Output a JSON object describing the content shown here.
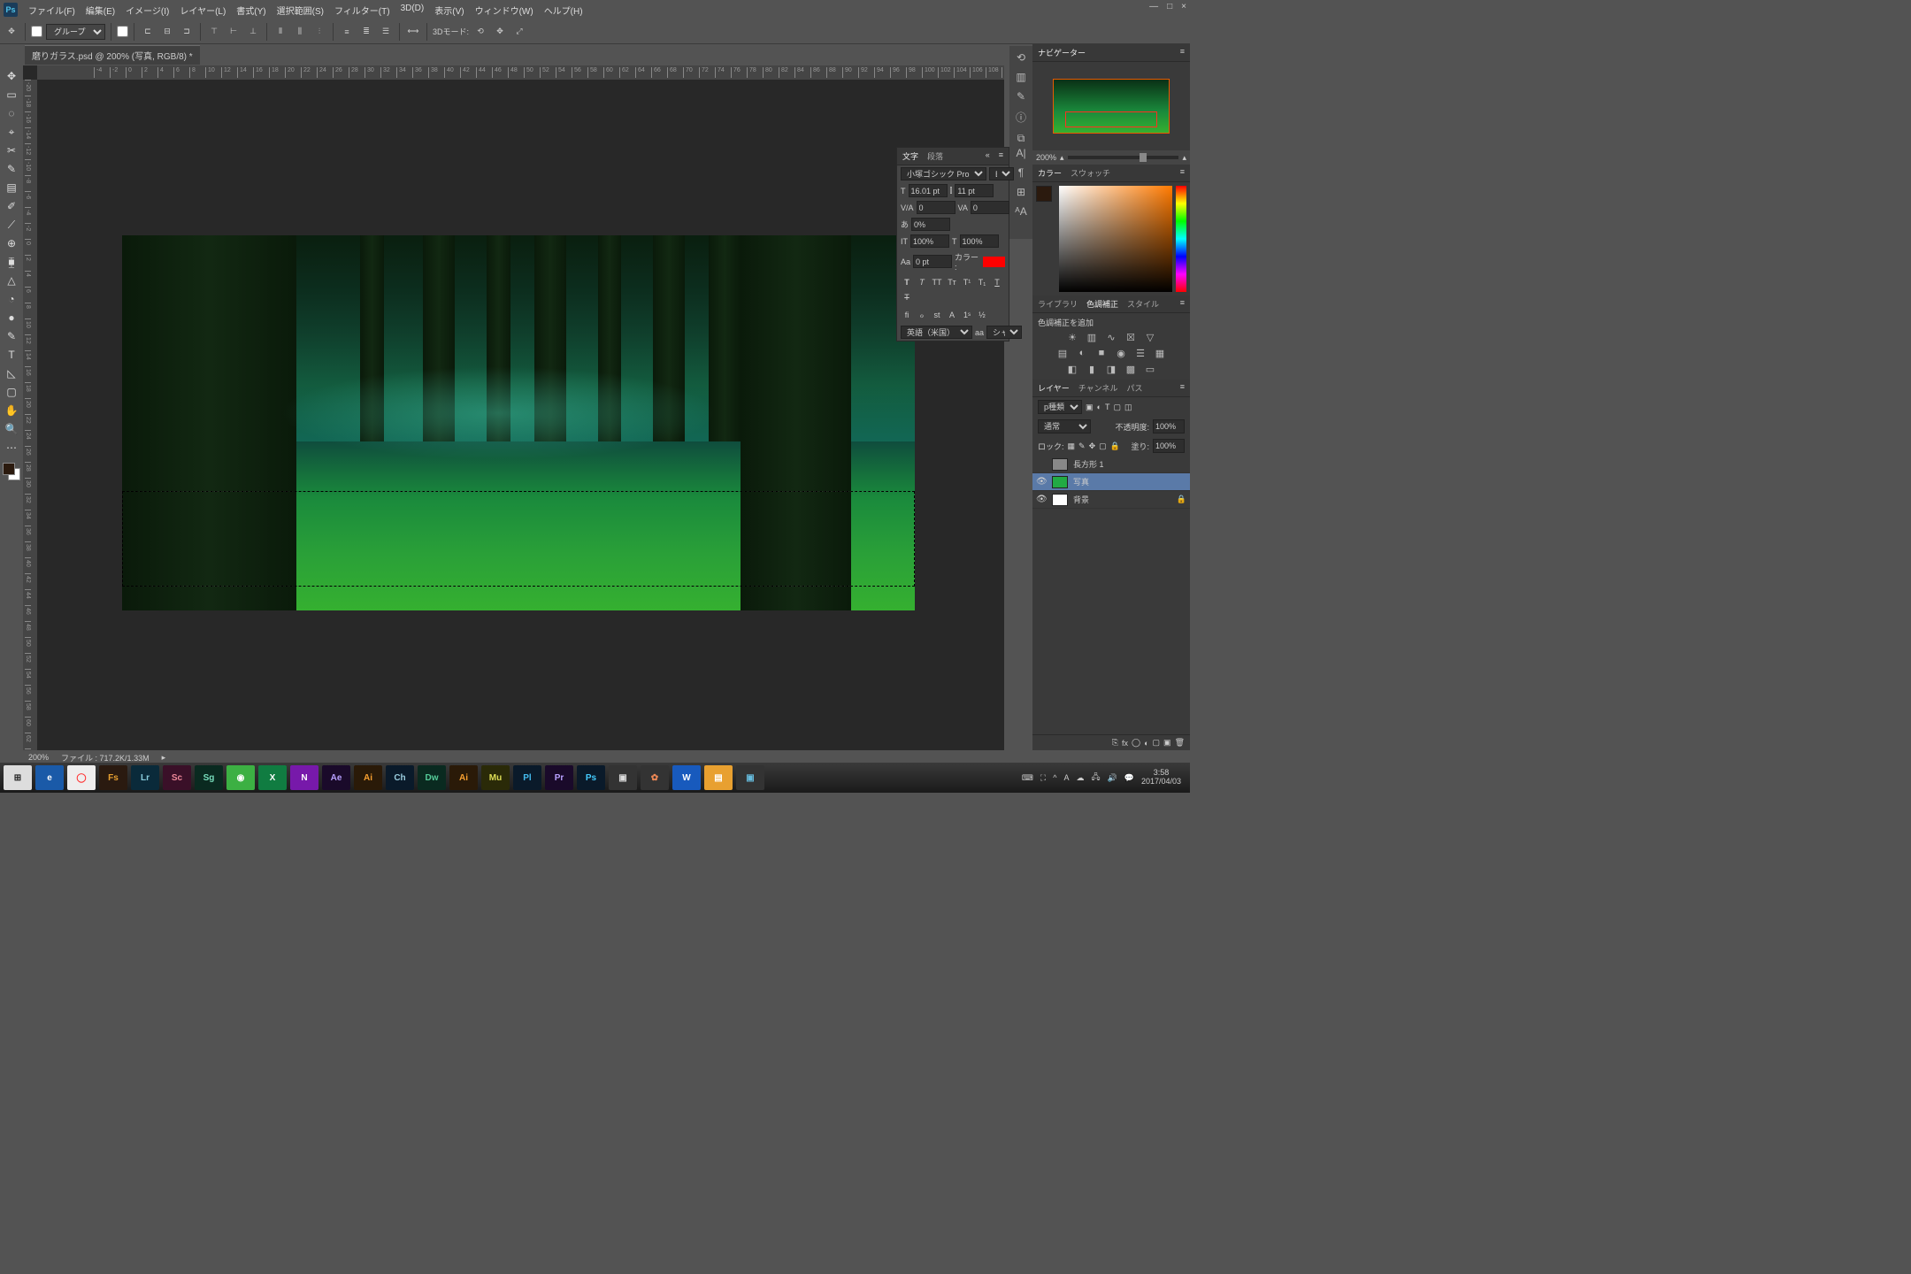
{
  "app": {
    "logo": "Ps"
  },
  "menu": [
    "ファイル(F)",
    "編集(E)",
    "イメージ(I)",
    "レイヤー(L)",
    "書式(Y)",
    "選択範囲(S)",
    "フィルター(T)",
    "3D(D)",
    "表示(V)",
    "ウィンドウ(W)",
    "ヘルプ(H)"
  ],
  "opt": {
    "group": "グループ",
    "mode3d": "3Dモード:"
  },
  "doc": {
    "tab": "磨りガラス.psd @ 200% (写真, RGB/8) *"
  },
  "status": {
    "zoom": "200%",
    "info": "ファイル : 717.2K/1.33M"
  },
  "navigator": {
    "title": "ナビゲーター",
    "zoom": "200%"
  },
  "color": {
    "tab1": "カラー",
    "tab2": "スウォッチ"
  },
  "lib": {
    "tab1": "ライブラリ",
    "tab2": "色調補正",
    "tab3": "スタイル",
    "add": "色調補正を追加"
  },
  "layers": {
    "tab1": "レイヤー",
    "tab2": "チャンネル",
    "tab3": "パス",
    "kind": "p種類",
    "blend": "通常",
    "opacityLabel": "不透明度:",
    "opacity": "100%",
    "lock": "ロック:",
    "fillLabel": "塗り:",
    "fill": "100%",
    "l1": "長方形 1",
    "l2": "写真",
    "l3": "背景"
  },
  "char": {
    "tab1": "文字",
    "tab2": "段落",
    "font": "小塚ゴシック Pro",
    "style": "B",
    "size": "16.01 pt",
    "leading": "11 pt",
    "va": "0",
    "vb": "0",
    "tsume": "0%",
    "pt0": "0 pt",
    "scaleH": "100%",
    "scaleV": "100%",
    "colorLabel": "カラー :",
    "lang": "英語（米国）",
    "aa": "シャープ"
  },
  "clock": {
    "time": "3:58",
    "date": "2017/04/03"
  },
  "taskbarApps": [
    {
      "t": "⊞",
      "bg": "#ddd",
      "c": "#222"
    },
    {
      "t": "e",
      "bg": "#1a5aa8",
      "c": "#fff"
    },
    {
      "t": "◯",
      "bg": "#eee",
      "c": "#f33"
    },
    {
      "t": "Fs",
      "bg": "#2a1a10",
      "c": "#e8a030"
    },
    {
      "t": "Lr",
      "bg": "#0a2a3a",
      "c": "#8cd"
    },
    {
      "t": "Sc",
      "bg": "#3a1028",
      "c": "#e89"
    },
    {
      "t": "Sg",
      "bg": "#0a2a20",
      "c": "#7db"
    },
    {
      "t": "◉",
      "bg": "#3cb043",
      "c": "#fff"
    },
    {
      "t": "X",
      "bg": "#107c41",
      "c": "#fff"
    },
    {
      "t": "N",
      "bg": "#7719aa",
      "c": "#fff"
    },
    {
      "t": "Ae",
      "bg": "#1a0a2a",
      "c": "#b8a0ff"
    },
    {
      "t": "Ai",
      "bg": "#2a1a08",
      "c": "#f8a030"
    },
    {
      "t": "Ch",
      "bg": "#0a1a2a",
      "c": "#9cd"
    },
    {
      "t": "Dw",
      "bg": "#0a2a20",
      "c": "#5c9"
    },
    {
      "t": "Ai",
      "bg": "#2a1a08",
      "c": "#f8a030"
    },
    {
      "t": "Mu",
      "bg": "#2a2a08",
      "c": "#dd5"
    },
    {
      "t": "Pl",
      "bg": "#0a1a2a",
      "c": "#4be"
    },
    {
      "t": "Pr",
      "bg": "#1a0a2a",
      "c": "#b8a0ff"
    },
    {
      "t": "Ps",
      "bg": "#0a1a2a",
      "c": "#4cf"
    },
    {
      "t": "▣",
      "bg": "#333",
      "c": "#ddd"
    },
    {
      "t": "✿",
      "bg": "#333",
      "c": "#e85"
    },
    {
      "t": "W",
      "bg": "#185abd",
      "c": "#fff"
    },
    {
      "t": "▤",
      "bg": "#e8a030",
      "c": "#fff"
    },
    {
      "t": "▣",
      "bg": "#333",
      "c": "#6bd"
    }
  ]
}
